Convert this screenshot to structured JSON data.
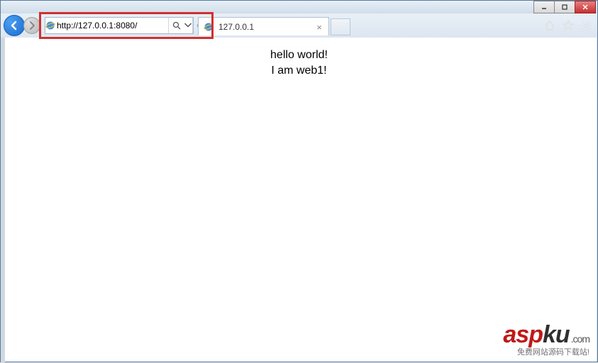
{
  "address": {
    "url": "http://127.0.0.1:8080/"
  },
  "tab": {
    "title": "127.0.0.1"
  },
  "page": {
    "line1": "hello world!",
    "line2": "I am web1!"
  },
  "watermark": {
    "brand_asp": "asp",
    "brand_ku": "ku",
    "tld": ".com",
    "tagline": "免费网站源码下载站!"
  }
}
